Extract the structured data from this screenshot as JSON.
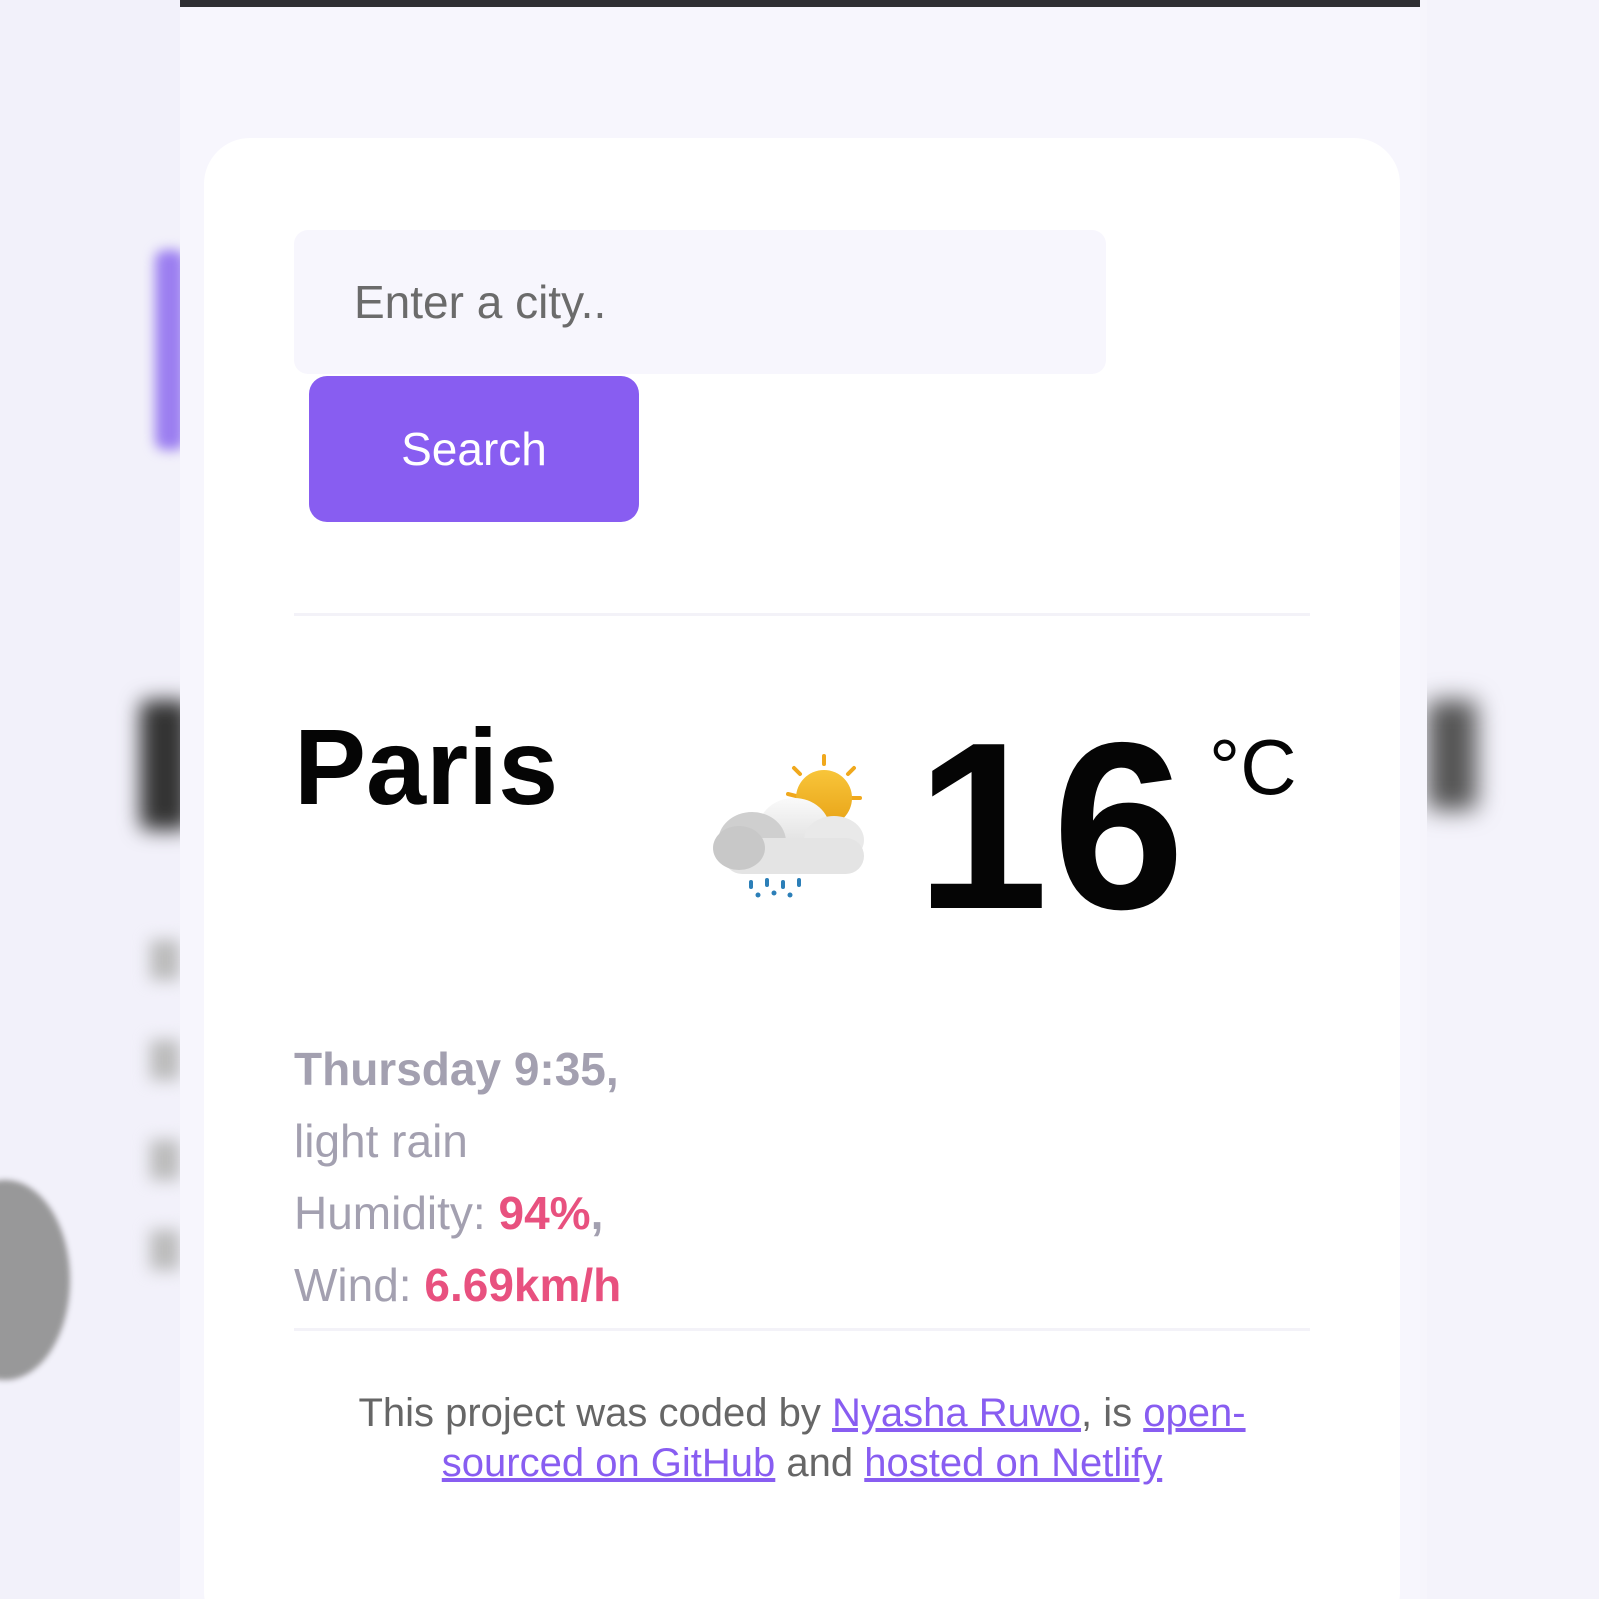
{
  "search": {
    "placeholder": "Enter a city..",
    "button_label": "Search"
  },
  "weather": {
    "city": "Paris",
    "day_time": "Thursday 9:35,",
    "description": "light rain",
    "humidity_label": "Humidity:",
    "humidity_value": "94%",
    "humidity_suffix": ",",
    "wind_label": "Wind:",
    "wind_value": "6.69km/h",
    "temperature": "16",
    "unit": "°C",
    "icon": "rain-cloud-sun-icon"
  },
  "footer": {
    "text_1": "This project was coded by ",
    "author_link": "Nyasha Ruwo",
    "text_2": ", is ",
    "github_link": "open-sourced on GitHub",
    "text_3": " and ",
    "netlify_link": "hosted on Netlify"
  },
  "colors": {
    "accent": "#885df1",
    "highlight": "#e8517f",
    "muted_text": "#a3a0b0"
  }
}
